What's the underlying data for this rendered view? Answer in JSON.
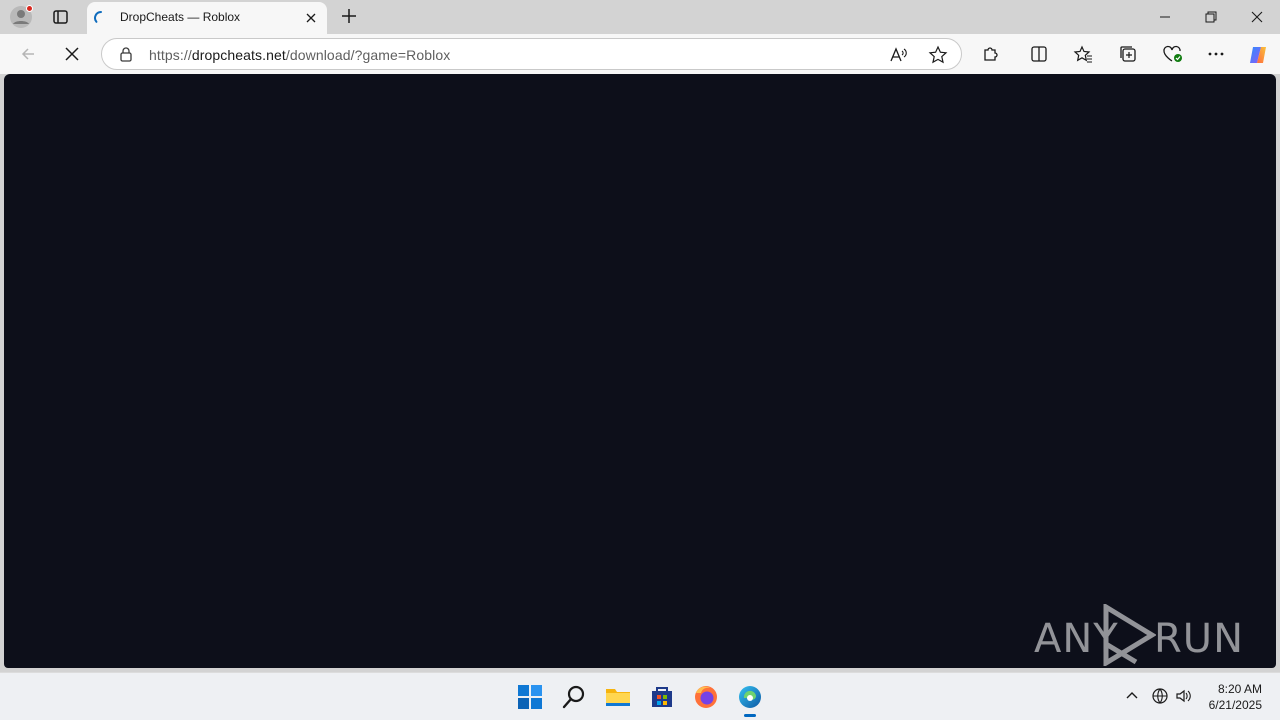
{
  "browser": {
    "tab": {
      "title": "DropCheats — Roblox",
      "favicon": "loading-spinner-icon"
    },
    "address": {
      "protocol": "https://",
      "host": "dropcheats.net",
      "path": "/download/?game=Roblox"
    },
    "icons": {
      "profile": "profile-icon",
      "tab_actions": "tab-actions-icon",
      "new_tab": "plus-icon",
      "back": "back-arrow-icon",
      "stop": "stop-x-icon",
      "site_info": "lock-icon",
      "read_aloud": "read-aloud-icon",
      "favorite": "star-icon",
      "extensions": "puzzle-icon",
      "split_screen": "split-screen-icon",
      "favorites": "favorites-icon",
      "collections": "collections-icon",
      "browser_essentials": "heart-pulse-icon",
      "more": "ellipsis-icon",
      "copilot": "copilot-icon"
    }
  },
  "watermark": {
    "left": "ANY",
    "right": "RUN"
  },
  "taskbar": {
    "apps": [
      "start-icon",
      "search-icon",
      "file-explorer-icon",
      "store-icon",
      "firefox-icon",
      "edge-icon"
    ],
    "time": "8:20 AM",
    "date": "6/21/2025"
  },
  "colors": {
    "page_background": "#0d0f1a",
    "chrome": "#d3d3d3",
    "toolbar": "#f7f7f7",
    "accent": "#0067c0"
  }
}
